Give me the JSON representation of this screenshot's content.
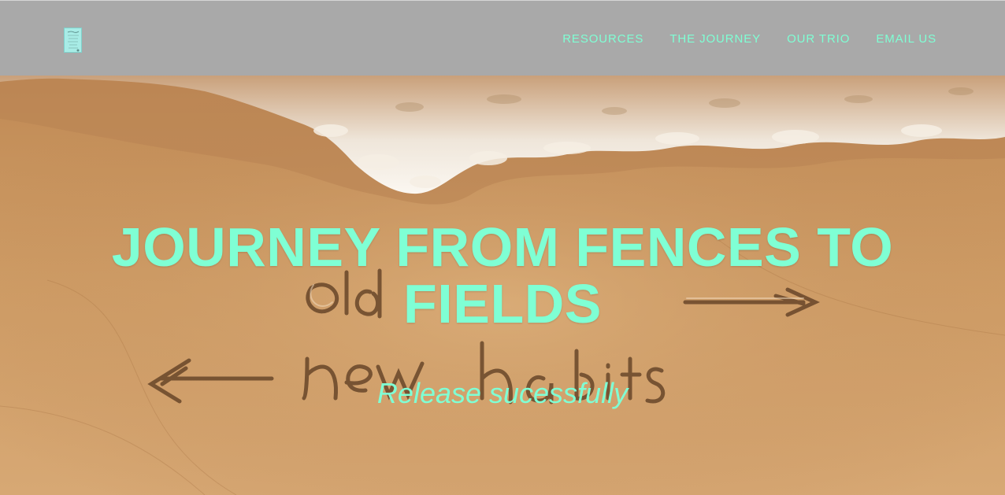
{
  "header": {
    "logo_icon": "book-cover-logo-icon",
    "nav": [
      {
        "label": "RESOURCES"
      },
      {
        "label": "THE JOURNEY"
      },
      {
        "label": "OUR TRIO"
      },
      {
        "label": "EMAIL US"
      }
    ]
  },
  "hero": {
    "title": "JOURNEY FROM FENCES TO FIELDS",
    "subtitle": "Release sucessfully",
    "sand_writing_top": "old habits",
    "sand_writing_bottom": "new habits",
    "background": "beach-sand-wave-image"
  },
  "colors": {
    "accent": "#7fffd4",
    "header_bg": "#a9a9a9",
    "sand": "#c99a63"
  }
}
